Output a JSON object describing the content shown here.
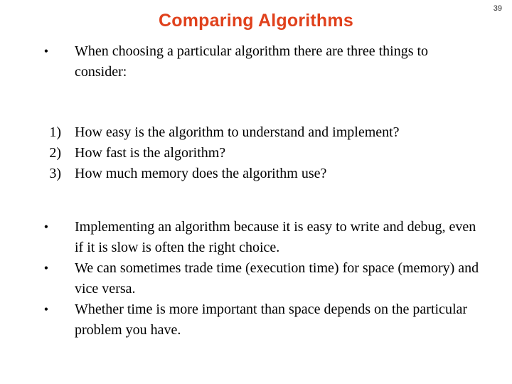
{
  "slide": {
    "title": "Comparing Algorithms",
    "title_color": "#e0411c",
    "page_number": "39",
    "background_color": "#ffffff",
    "text_color": "#000000"
  },
  "blocks": [
    {
      "type": "bulleted",
      "items": [
        {
          "marker": "•",
          "text": "When choosing a particular algorithm there are three things to consider:"
        }
      ]
    },
    {
      "type": "numbered",
      "items": [
        {
          "marker": "1)",
          "text": "How easy is the algorithm to understand and implement?"
        },
        {
          "marker": "2)",
          "text": "How fast is the algorithm?"
        },
        {
          "marker": "3)",
          "text": "How much memory does the algorithm use?"
        }
      ]
    },
    {
      "type": "bulleted",
      "items": [
        {
          "marker": "•",
          "text": "Implementing an algorithm because it is easy to write and debug, even if it is slow is often the right choice."
        },
        {
          "marker": "•",
          "text": "We can sometimes trade time (execution time) for space (memory) and vice versa."
        },
        {
          "marker": "•",
          "text": "Whether time is more important than space depends on the particular problem you have."
        }
      ]
    }
  ]
}
